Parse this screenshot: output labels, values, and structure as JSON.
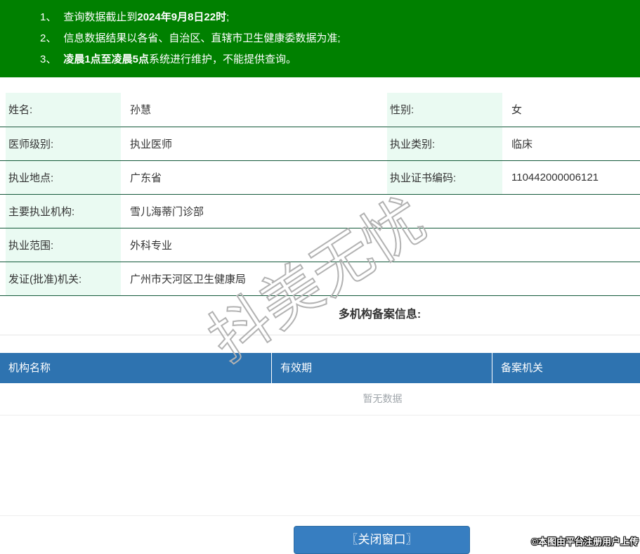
{
  "banner": {
    "items": [
      {
        "num": "1、",
        "pre": "查询数据截止到",
        "bold": "2024年9月8日22时",
        "post": ";"
      },
      {
        "num": "2、",
        "pre": "信息数据结果以各省、自治区、直辖市卫生健康委数据为准;",
        "bold": "",
        "post": ""
      },
      {
        "num": "3、",
        "pre": "",
        "bold": "凌晨1点至凌晨5点",
        "post": "系统进行维护，不能提供查询。"
      }
    ]
  },
  "info": {
    "rows": [
      {
        "label": "姓名:",
        "value": "孙慧",
        "label2": "性别:",
        "value2": "女"
      },
      {
        "label": "医师级别:",
        "value": "执业医师",
        "label2": "执业类别:",
        "value2": "临床"
      },
      {
        "label": "执业地点:",
        "value": "广东省",
        "label2": "执业证书编码:",
        "value2": "110442000006121"
      },
      {
        "label": "主要执业机构:",
        "value": "雪儿海蒂门诊部"
      },
      {
        "label": "执业范围:",
        "value": "外科专业"
      },
      {
        "label": "发证(批准)机关:",
        "value": "广州市天河区卫生健康局"
      }
    ]
  },
  "section": {
    "title": "多机构备案信息:"
  },
  "registration_table": {
    "headers": [
      "机构名称",
      "有效期",
      "备案机关"
    ],
    "empty_text": "暂无数据"
  },
  "watermark": {
    "text": "抖美无忧"
  },
  "footer": {
    "close_button_label": "〖关闭窗口〗"
  },
  "attribution": {
    "text": "©本图由平台注册用户上传"
  },
  "colors": {
    "banner_green": "#008000",
    "row_border_green": "#14593a",
    "label_cell_mint": "#eafaf2",
    "table_header_blue": "#2e73b0",
    "button_blue": "#377ec1",
    "button_border_blue": "#2d6ca2",
    "empty_text_gray": "#a0a6ab"
  }
}
